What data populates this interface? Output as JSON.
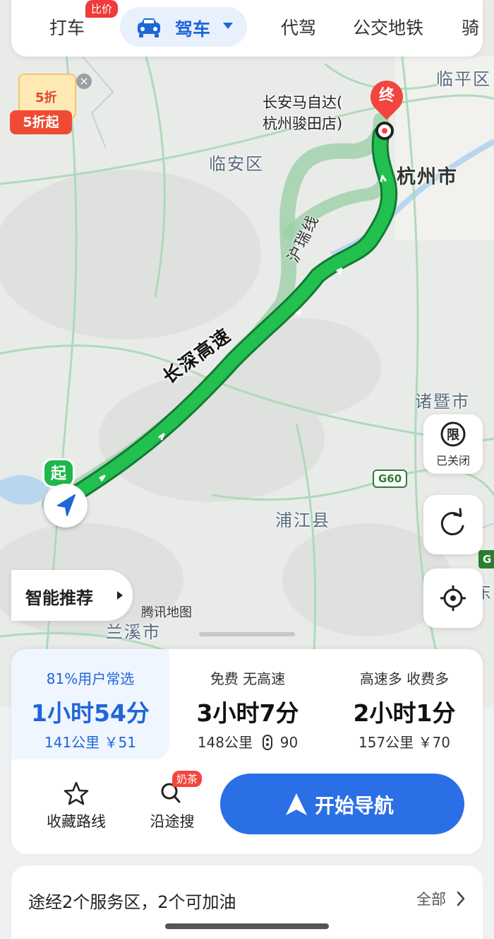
{
  "tabs": {
    "items": [
      "打车",
      "驾车",
      "代驾",
      "公交地铁",
      "骑"
    ],
    "active": "驾车",
    "badge": "比价"
  },
  "coupon": {
    "ticket_text": "5折",
    "tag": "5折起"
  },
  "map": {
    "places": {
      "linping": "临平区",
      "linan": "临安区",
      "hangzhou": "杭州市",
      "zhuji": "诸暨市",
      "pujiang": "浦江县",
      "lanxi": "兰溪市",
      "dong": "东"
    },
    "destination": {
      "pin": "终",
      "line1": "长安马自达(",
      "line2": "杭州骏田店)"
    },
    "start_pin": "起",
    "main_road": "长深高速",
    "alt_road": "沪瑞线",
    "g60": "G60",
    "g_edge": "G",
    "watermark": "腾讯地图"
  },
  "side_buttons": {
    "limit_icon": "限",
    "limit_caption": "已关闭"
  },
  "smart_recommend": "智能推荐",
  "route_options": [
    {
      "tag": "81%用户常选",
      "time": "1小时54分",
      "meta": "141公里 ￥51",
      "selected": true
    },
    {
      "tag": "免费 无高速",
      "time": "3小时7分",
      "meta_distance": "148公里",
      "meta_lights": "90",
      "selected": false
    },
    {
      "tag": "高速多 收费多",
      "time": "2小时1分",
      "meta": "157公里 ￥70",
      "selected": false
    }
  ],
  "actions": {
    "favorite": "收藏路线",
    "search_along": "沿途搜",
    "search_badge": "奶茶",
    "start_nav": "开始导航"
  },
  "service_bar": {
    "text": "途经2个服务区，2个可加油",
    "all": "全部"
  },
  "colors": {
    "accent": "#2a6fe5",
    "route": "#1eb84a",
    "dest": "#f2453d"
  }
}
